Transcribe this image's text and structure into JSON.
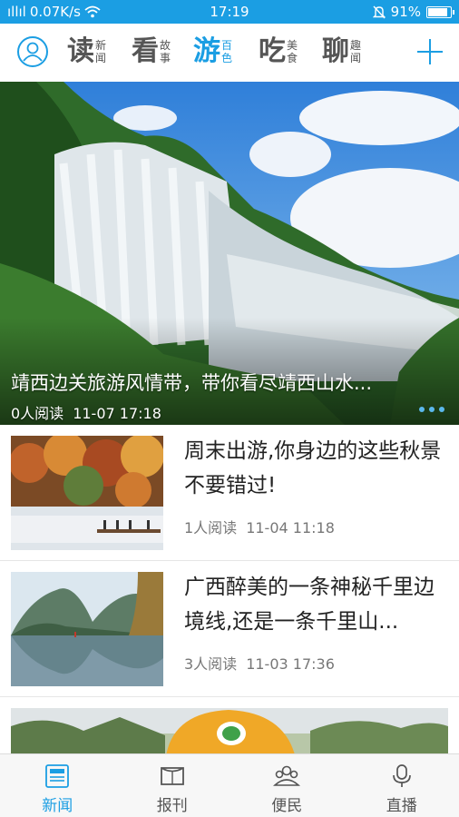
{
  "status_bar": {
    "carrier": "ıllıl",
    "speed": "0.07K/s",
    "time": "17:19",
    "battery_percent": "91%",
    "battery_level": 0.91
  },
  "top_nav": {
    "tabs": [
      {
        "big": "读",
        "small1": "新",
        "small2": "闻",
        "active": false
      },
      {
        "big": "看",
        "small1": "故",
        "small2": "事",
        "active": false
      },
      {
        "big": "游",
        "small1": "百",
        "small2": "色",
        "active": true
      },
      {
        "big": "吃",
        "small1": "美",
        "small2": "食",
        "active": false
      },
      {
        "big": "聊",
        "small1": "趣",
        "small2": "闻",
        "active": false
      }
    ]
  },
  "hero": {
    "title": "靖西边关旅游风情带，带你看尽靖西山水...",
    "reads": "0人阅读",
    "time": "11-07 17:18"
  },
  "articles": [
    {
      "title": "周末出游,你身边的这些秋景不要错过!",
      "reads": "1人阅读",
      "time": "11-04 11:18"
    },
    {
      "title": "广西醉美的一条神秘千里边境线,还是一条千里山...",
      "reads": "3人阅读",
      "time": "11-03 17:36"
    }
  ],
  "bottom_bar": {
    "items": [
      {
        "label": "新闻",
        "icon": "newspaper-icon",
        "active": true
      },
      {
        "label": "报刊",
        "icon": "magazine-icon",
        "active": false
      },
      {
        "label": "便民",
        "icon": "people-icon",
        "active": false
      },
      {
        "label": "直播",
        "icon": "microphone-icon",
        "active": false
      }
    ]
  },
  "colors": {
    "accent": "#1b9ee3",
    "text": "#222222",
    "muted": "#777777"
  }
}
